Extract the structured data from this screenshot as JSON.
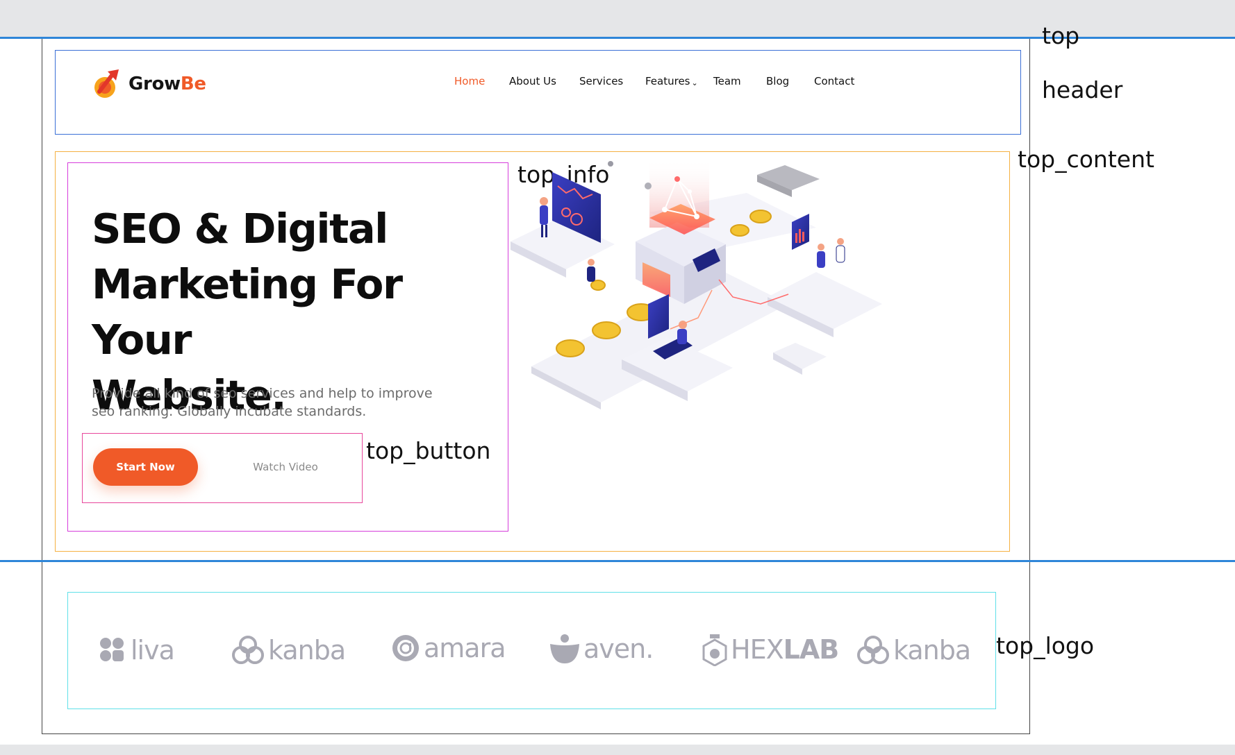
{
  "brand": {
    "name_part1": "Grow",
    "name_part2": "Be",
    "accent": "#f05a28",
    "icon": "rocket-arrow-logo"
  },
  "nav": {
    "items": [
      {
        "label": "Home",
        "active": true
      },
      {
        "label": "About Us"
      },
      {
        "label": "Services"
      },
      {
        "label": "Features",
        "has_dropdown": true
      },
      {
        "label": "Team"
      },
      {
        "label": "Blog"
      },
      {
        "label": "Contact"
      }
    ]
  },
  "hero": {
    "title_line1": "SEO & Digital",
    "title_line2": "Marketing For Your",
    "title_line3": "Website.",
    "subtitle_line1": "Provide all kind of seo services and help to improve",
    "subtitle_line2": "seo ranking. Globally incubate standards.",
    "primary_button": "Start Now",
    "secondary_button": "Watch Video"
  },
  "annotations": {
    "top": "top",
    "header": "header",
    "top_content": "top_content",
    "top_info": "top_info",
    "top_button": "top_button",
    "top_logo": "top_logo"
  },
  "partner_logos": [
    {
      "name": "liva",
      "icon": "liva-leaf-icon"
    },
    {
      "name": "kanba",
      "icon": "kanba-rings-icon"
    },
    {
      "name": "amara",
      "icon": "amara-at-icon"
    },
    {
      "name": "aven.",
      "icon": "aven-drop-icon"
    },
    {
      "name_part1": "HEX",
      "name_part2": "LAB",
      "icon": "hexlab-flask-icon"
    },
    {
      "name": "kanba",
      "icon": "kanba-rings-icon"
    }
  ],
  "colors": {
    "accent": "#f05a28",
    "guide_blue": "#2f86d8",
    "header_box": "#3a6fd6",
    "content_box": "#f5b041",
    "info_box": "#d63ddb",
    "button_box": "#e8469b",
    "logo_box": "#5fe0e8",
    "logo_gray": "#a9a9b3"
  }
}
